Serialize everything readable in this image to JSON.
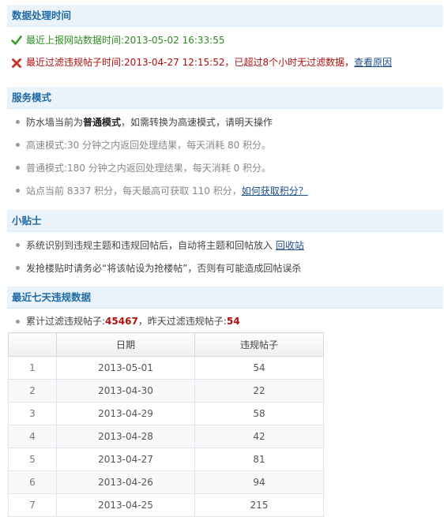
{
  "sections": {
    "processing": {
      "title": "数据处理时间"
    },
    "service": {
      "title": "服务模式"
    },
    "tips": {
      "title": "小贴士"
    },
    "stats": {
      "title": "最近七天违规数据"
    }
  },
  "processing": {
    "last_report_label": "最近上报网站数据时间:",
    "last_report_time": "2013-05-02 16:33:55",
    "last_filter_label": "最近过滤违规帖子时间:",
    "last_filter_time": "2013-04-27 12:15:52",
    "warning_text": "，已超过8个小时无过滤数据，",
    "reason_link": "查看原因"
  },
  "service": {
    "current_prefix": "防水墙当前为",
    "current_mode": "普通模式",
    "current_suffix": "，如需转换为高速模式，请明天操作",
    "high_speed": "高速模式:30 分钟之内返回处理结果，每天消耗 80 积分。",
    "normal": "普通模式:180 分钟之内返回处理结果，每天消耗 0 积分。",
    "points_prefix": "站点当前 8337 积分，每天最高可获取 110 积分，",
    "points_link": "如何获取积分？"
  },
  "tips": {
    "tip1_prefix": "系统识别到违规主题和违规回帖后，自动将主题和回帖放入 ",
    "tip1_link": "回收站",
    "tip2": "发抢楼贴时请务必“将该帖设为抢楼帖”，否则有可能造成回帖误杀"
  },
  "stats": {
    "total_label": "累计过滤违规帖子:",
    "total_value": "45467",
    "yesterday_label": "，昨天过滤违规帖子:",
    "yesterday_value": "54",
    "table": {
      "headers": [
        "",
        "日期",
        "违规帖子"
      ],
      "rows": [
        [
          "1",
          "2013-05-01",
          "54"
        ],
        [
          "2",
          "2013-04-30",
          "22"
        ],
        [
          "3",
          "2013-04-29",
          "58"
        ],
        [
          "4",
          "2013-04-28",
          "42"
        ],
        [
          "5",
          "2013-04-27",
          "81"
        ],
        [
          "6",
          "2013-04-26",
          "94"
        ],
        [
          "7",
          "2013-04-25",
          "215"
        ]
      ]
    }
  },
  "colors": {
    "header_bg": "#eaf3fa",
    "header_text": "#1f6aa5",
    "ok": "#2e8b22",
    "error": "#b30e0e",
    "link": "#1c4f8a"
  },
  "icons": {
    "ok": "check-icon",
    "error": "cross-icon"
  }
}
